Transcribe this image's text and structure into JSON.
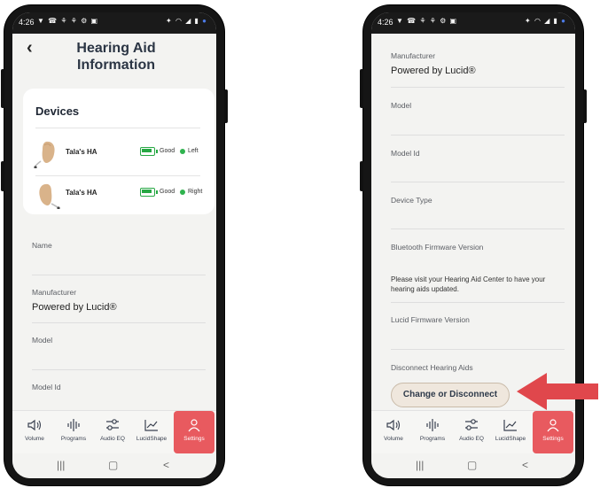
{
  "status_bar": {
    "time": "4:26",
    "notification_icons": "▼ ☎ ⚘ ⚘ ⚙ ▣",
    "system_icons": "✦ ◠ ◢ ▮"
  },
  "left_screen": {
    "title_line1": "Hearing Aid",
    "title_line2": "Information",
    "devices": {
      "title": "Devices",
      "items": [
        {
          "name": "Tala's HA",
          "battery": "Good",
          "side": "Left"
        },
        {
          "name": "Tala's HA",
          "battery": "Good",
          "side": "Right"
        }
      ]
    },
    "fields": {
      "name_label": "Name",
      "manufacturer_label": "Manufacturer",
      "manufacturer_value": "Powered by Lucid®",
      "model_label": "Model",
      "model_id_label": "Model Id"
    }
  },
  "right_screen": {
    "manufacturer_label": "Manufacturer",
    "manufacturer_value": "Powered by Lucid®",
    "model_label": "Model",
    "model_id_label": "Model Id",
    "device_type_label": "Device Type",
    "bt_firmware_label": "Bluetooth Firmware Version",
    "bt_firmware_note": "Please visit your Hearing Aid Center to have your hearing aids updated.",
    "lucid_firmware_label": "Lucid Firmware Version",
    "disconnect_label": "Disconnect Hearing Aids",
    "change_button": "Change or Disconnect"
  },
  "bottom_nav": {
    "items": [
      {
        "label": "Volume",
        "icon": "speaker-icon"
      },
      {
        "label": "Programs",
        "icon": "bars-icon"
      },
      {
        "label": "Audio EQ",
        "icon": "sliders-icon"
      },
      {
        "label": "LucidShape",
        "icon": "chart-icon"
      },
      {
        "label": "Settings",
        "icon": "person-icon"
      }
    ],
    "active": "Settings"
  },
  "android_nav": {
    "recents": "|||",
    "home": "▢",
    "back": "<"
  },
  "colors": {
    "accent": "#e85a5f",
    "battery_good": "#27a844",
    "arrow": "#e0474c"
  }
}
